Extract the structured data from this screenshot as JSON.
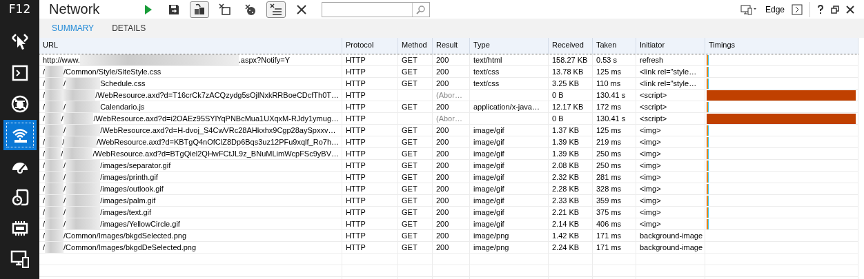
{
  "sidebar": {
    "title": "F12",
    "items": [
      {
        "kind": "pointer",
        "selected": false
      },
      {
        "kind": "console",
        "selected": false
      },
      {
        "kind": "debugger",
        "selected": false
      },
      {
        "kind": "network",
        "selected": true
      },
      {
        "kind": "performance",
        "selected": false
      },
      {
        "kind": "memory",
        "selected": false
      },
      {
        "kind": "chip",
        "selected": false
      },
      {
        "kind": "emulation",
        "selected": false
      }
    ]
  },
  "toolbar": {
    "title": "Network",
    "buttons": [
      {
        "kind": "play",
        "pressed": false
      },
      {
        "kind": "save",
        "pressed": false
      },
      {
        "kind": "clear-entries",
        "pressed": true
      },
      {
        "kind": "clear-cache",
        "pressed": false
      },
      {
        "kind": "clear-cookies",
        "pressed": false
      },
      {
        "kind": "always-refresh",
        "pressed": true
      },
      {
        "kind": "clear",
        "pressed": false
      }
    ],
    "target": "Edge"
  },
  "tabs": [
    {
      "label": "SUMMARY",
      "selected": true
    },
    {
      "label": "DETAILS",
      "selected": false
    }
  ],
  "table": {
    "columns": [
      "URL",
      "Protocol",
      "Method",
      "Result",
      "Type",
      "Received",
      "Taken",
      "Initiator",
      "Timings"
    ],
    "rows": [
      {
        "kind": "loaded",
        "url": [
          {
            "kind": "text",
            "text": "http://www."
          },
          {
            "kind": "domain-blur"
          },
          {
            "kind": "text",
            "text": ".aspx?Notify=Y"
          }
        ],
        "protocol": "HTTP",
        "method": "GET",
        "result": "200",
        "type": "text/html",
        "received": "158.27 KB",
        "taken": "0.53 s",
        "initiator": "refresh"
      },
      {
        "kind": "loaded",
        "url": [
          {
            "kind": "text",
            "text": "/"
          },
          {
            "kind": "folder-blur"
          },
          {
            "kind": "text",
            "text": "/Common/Style/SiteStyle.css"
          }
        ],
        "protocol": "HTTP",
        "method": "GET",
        "result": "200",
        "type": "text/css",
        "received": "13.78 KB",
        "taken": "125 ms",
        "initiator": "<link rel=\"style…"
      },
      {
        "kind": "loaded",
        "url": [
          {
            "kind": "text",
            "text": "/"
          },
          {
            "kind": "folder-blur"
          },
          {
            "kind": "text",
            "text": "/"
          },
          {
            "kind": "path-blur"
          },
          {
            "kind": "text",
            "text": "Schedule.css"
          }
        ],
        "protocol": "HTTP",
        "method": "GET",
        "result": "200",
        "type": "text/css",
        "received": "3.25 KB",
        "taken": "110 ms",
        "initiator": "<link rel=\"style…"
      },
      {
        "kind": "aborted",
        "url": [
          {
            "kind": "text",
            "text": "/"
          },
          {
            "kind": "folder-blur"
          },
          {
            "kind": "path-blur"
          },
          {
            "kind": "text",
            "text": "/WebResource.axd?d=T16crCk7zACQzydg5sOjlNxkRRBoeCDcfTh0T…"
          }
        ],
        "protocol": "HTTP",
        "method": "",
        "result": "(Abor…",
        "type": "",
        "received": "0 B",
        "taken": "130.41 s",
        "initiator": "<script>"
      },
      {
        "kind": "loaded",
        "url": [
          {
            "kind": "text",
            "text": "/"
          },
          {
            "kind": "folder-blur"
          },
          {
            "kind": "text",
            "text": "/"
          },
          {
            "kind": "path-blur"
          },
          {
            "kind": "text",
            "text": "Calendario.js"
          }
        ],
        "protocol": "HTTP",
        "method": "GET",
        "result": "200",
        "type": "application/x-java…",
        "received": "12.17 KB",
        "taken": "172 ms",
        "initiator": "<script>"
      },
      {
        "kind": "aborted",
        "url": [
          {
            "kind": "text",
            "text": "/"
          },
          {
            "kind": "folder-blur"
          },
          {
            "kind": "text",
            "text": "/"
          },
          {
            "kind": "path-blur"
          },
          {
            "kind": "text",
            "text": "/WebResource.axd?d=i2OAEz95SYlYqPNBcMua1UXqxM-RJdy1ymug…"
          }
        ],
        "protocol": "HTTP",
        "method": "",
        "result": "(Abor…",
        "type": "",
        "received": "0 B",
        "taken": "130.41 s",
        "initiator": "<script>"
      },
      {
        "kind": "loaded",
        "url": [
          {
            "kind": "text",
            "text": "/"
          },
          {
            "kind": "folder-blur"
          },
          {
            "kind": "text",
            "text": "/"
          },
          {
            "kind": "path-blur"
          },
          {
            "kind": "text",
            "text": "/WebResource.axd?d=H-dvoj_S4CwVRc28AHkxhx9Cgp28aySpxxv…"
          }
        ],
        "protocol": "HTTP",
        "method": "GET",
        "result": "200",
        "type": "image/gif",
        "received": "1.37 KB",
        "taken": "125 ms",
        "initiator": "<img>"
      },
      {
        "kind": "loaded",
        "url": [
          {
            "kind": "text",
            "text": "/"
          },
          {
            "kind": "folder-blur"
          },
          {
            "kind": "text",
            "text": "/"
          },
          {
            "kind": "path-blur"
          },
          {
            "kind": "text",
            "text": "/WebResource.axd?d=KBTgQ4nOfClZ8Dp6Bqs3uz12PFu9xqlf_Ro7h…"
          }
        ],
        "protocol": "HTTP",
        "method": "GET",
        "result": "200",
        "type": "image/gif",
        "received": "1.39 KB",
        "taken": "219 ms",
        "initiator": "<img>"
      },
      {
        "kind": "loaded",
        "url": [
          {
            "kind": "text",
            "text": "/"
          },
          {
            "kind": "folder-blur"
          },
          {
            "kind": "text",
            "text": "/"
          },
          {
            "kind": "path-blur"
          },
          {
            "kind": "text",
            "text": "/WebResource.axd?d=BTgQiel2QHwFCtJL9z_BNuMLimWcpFSc9yBV…"
          }
        ],
        "protocol": "HTTP",
        "method": "GET",
        "result": "200",
        "type": "image/gif",
        "received": "1.39 KB",
        "taken": "250 ms",
        "initiator": "<img>"
      },
      {
        "kind": "loaded",
        "url": [
          {
            "kind": "text",
            "text": "/"
          },
          {
            "kind": "folder-blur"
          },
          {
            "kind": "text",
            "text": "/"
          },
          {
            "kind": "path-blur"
          },
          {
            "kind": "text",
            "text": "/images/separator.gif"
          }
        ],
        "protocol": "HTTP",
        "method": "GET",
        "result": "200",
        "type": "image/gif",
        "received": "2.08 KB",
        "taken": "250 ms",
        "initiator": "<img>"
      },
      {
        "kind": "loaded",
        "url": [
          {
            "kind": "text",
            "text": "/"
          },
          {
            "kind": "folder-blur"
          },
          {
            "kind": "text",
            "text": "/"
          },
          {
            "kind": "path-blur"
          },
          {
            "kind": "text",
            "text": "/images/printh.gif"
          }
        ],
        "protocol": "HTTP",
        "method": "GET",
        "result": "200",
        "type": "image/gif",
        "received": "2.32 KB",
        "taken": "281 ms",
        "initiator": "<img>"
      },
      {
        "kind": "loaded",
        "url": [
          {
            "kind": "text",
            "text": "/"
          },
          {
            "kind": "folder-blur"
          },
          {
            "kind": "text",
            "text": "/"
          },
          {
            "kind": "path-blur"
          },
          {
            "kind": "text",
            "text": "/images/outlook.gif"
          }
        ],
        "protocol": "HTTP",
        "method": "GET",
        "result": "200",
        "type": "image/gif",
        "received": "2.28 KB",
        "taken": "328 ms",
        "initiator": "<img>"
      },
      {
        "kind": "loaded",
        "url": [
          {
            "kind": "text",
            "text": "/"
          },
          {
            "kind": "folder-blur"
          },
          {
            "kind": "text",
            "text": "/"
          },
          {
            "kind": "path-blur"
          },
          {
            "kind": "text",
            "text": "/images/palm.gif"
          }
        ],
        "protocol": "HTTP",
        "method": "GET",
        "result": "200",
        "type": "image/gif",
        "received": "2.33 KB",
        "taken": "359 ms",
        "initiator": "<img>"
      },
      {
        "kind": "loaded",
        "url": [
          {
            "kind": "text",
            "text": "/"
          },
          {
            "kind": "folder-blur"
          },
          {
            "kind": "text",
            "text": "/"
          },
          {
            "kind": "path-blur"
          },
          {
            "kind": "text",
            "text": "/images/text.gif"
          }
        ],
        "protocol": "HTTP",
        "method": "GET",
        "result": "200",
        "type": "image/gif",
        "received": "2.21 KB",
        "taken": "375 ms",
        "initiator": "<img>"
      },
      {
        "kind": "loaded",
        "url": [
          {
            "kind": "text",
            "text": "/"
          },
          {
            "kind": "folder-blur"
          },
          {
            "kind": "text",
            "text": "/"
          },
          {
            "kind": "path-blur"
          },
          {
            "kind": "text",
            "text": "/images/YellowCircle.gif"
          }
        ],
        "protocol": "HTTP",
        "method": "GET",
        "result": "200",
        "type": "image/gif",
        "received": "2.14 KB",
        "taken": "406 ms",
        "initiator": "<img>"
      },
      {
        "kind": "untimed",
        "url": [
          {
            "kind": "text",
            "text": "/"
          },
          {
            "kind": "folder-blur"
          },
          {
            "kind": "text",
            "text": "/Common/Images/bkgdSelected.png"
          }
        ],
        "protocol": "HTTP",
        "method": "GET",
        "result": "200",
        "type": "image/png",
        "received": "1.42 KB",
        "taken": "171 ms",
        "initiator": "background-image"
      },
      {
        "kind": "untimed",
        "url": [
          {
            "kind": "text",
            "text": "/"
          },
          {
            "kind": "folder-blur"
          },
          {
            "kind": "text",
            "text": "/Common/Images/bkgdDeSelected.png"
          }
        ],
        "protocol": "HTTP",
        "method": "GET",
        "result": "200",
        "type": "image/png",
        "received": "2.24 KB",
        "taken": "171 ms",
        "initiator": "background-image"
      }
    ]
  }
}
